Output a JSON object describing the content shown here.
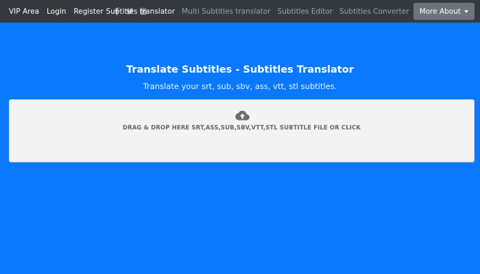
{
  "navbar": {
    "left_links": [
      {
        "label": "VIP Area"
      },
      {
        "label": "Login"
      },
      {
        "label": "Register"
      }
    ],
    "social_icons": [
      "facebook-icon",
      "twitter-icon",
      "youtube-icon"
    ],
    "menu": [
      {
        "label": "Subtitles translator",
        "active": true
      },
      {
        "label": "Multi Subtitles translator",
        "active": false
      },
      {
        "label": "Subtitles Editor",
        "active": false
      },
      {
        "label": "Subtitles Converter",
        "active": false
      }
    ],
    "more_about": {
      "label": "More About",
      "icon": "chevron-down-icon"
    }
  },
  "hero": {
    "title": "Translate Subtitles - Subtitles Translator",
    "subtitle": "Translate your srt, sub, sbv, ass, vtt, stl subtitles."
  },
  "dropzone": {
    "icon": "cloud-upload-icon",
    "text": "DRAG & DROP HERE SRT,ASS,SUB,SBV,VTT,STL SUBTITLE FILE OR CLICK"
  },
  "colors": {
    "background": "#0a79ff",
    "navbar": "#343a40",
    "dropdown_button": "#6c757d",
    "dropzone": "#f3f3f3"
  }
}
